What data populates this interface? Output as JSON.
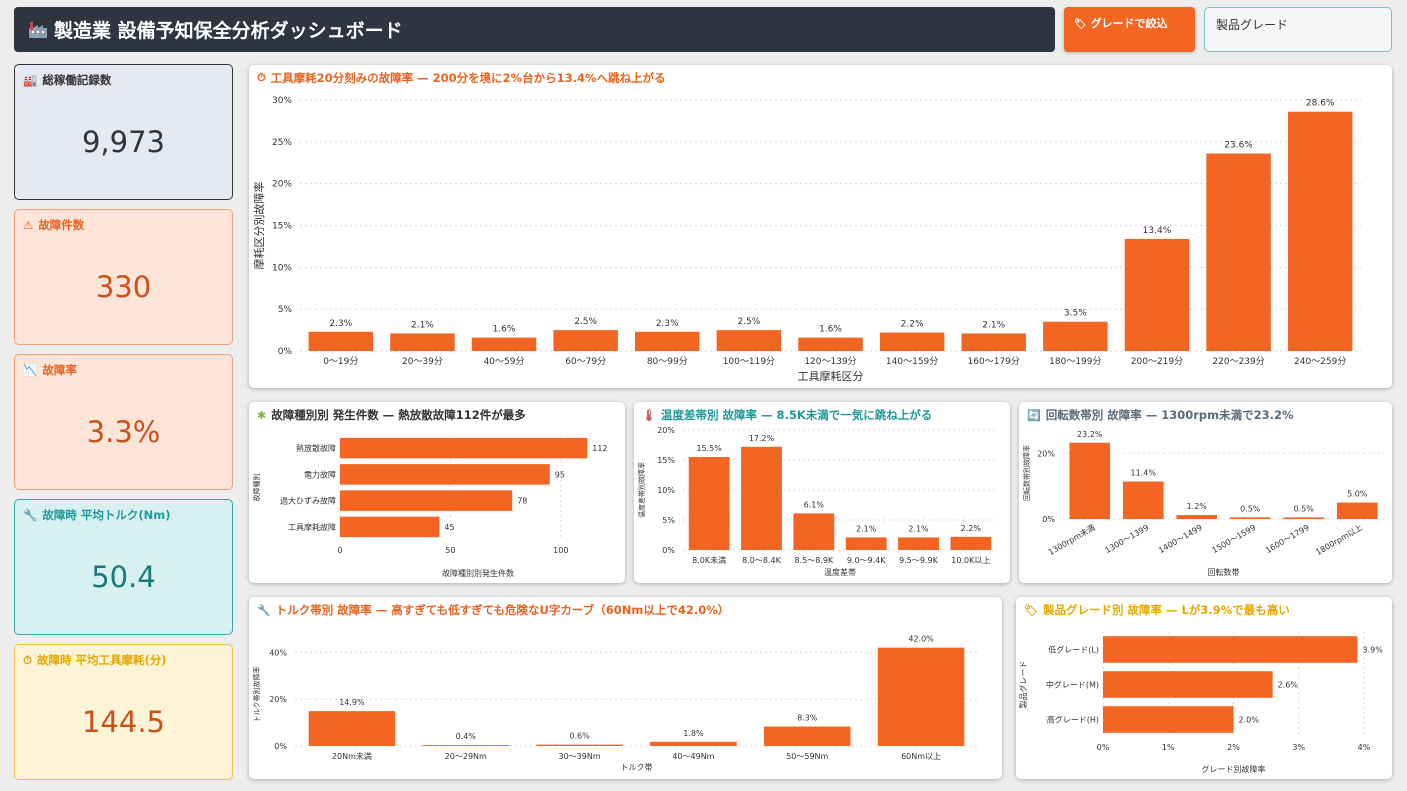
{
  "header": {
    "title": "製造業 設備予知保全分析ダッシュボード",
    "icon": "factory-icon"
  },
  "filter": {
    "button_label": "グレードで絞込",
    "select_placeholder": "製品グレード"
  },
  "kpis": [
    {
      "label": "総稼働記録数",
      "value": "9,973",
      "icon": "factory-icon",
      "bg": "#e6e9ef",
      "border": "#2e3440",
      "label_color": "#333333",
      "value_color": "#2e3440"
    },
    {
      "label": "故障件数",
      "value": "330",
      "icon": "warning-icon",
      "bg": "#fde4d8",
      "border": "#f0a07a",
      "label_color": "#e8631f",
      "value_color": "#c9511a"
    },
    {
      "label": "故障率",
      "value": "3.3%",
      "icon": "chart-down-icon",
      "bg": "#fde4d8",
      "border": "#f0a07a",
      "label_color": "#e8631f",
      "value_color": "#c9511a"
    },
    {
      "label": "故障時 平均トルク(Nm)",
      "value": "50.4",
      "icon": "wrench-icon",
      "bg": "#d9f0f0",
      "border": "#33a6a6",
      "label_color": "#1f9a9a",
      "value_color": "#167a7a"
    },
    {
      "label": "故障時 平均工具摩耗(分)",
      "value": "144.5",
      "icon": "stopwatch-icon",
      "bg": "#fdf3d6",
      "border": "#f2c24a",
      "label_color": "#e6a800",
      "value_color": "#c9511a"
    }
  ],
  "colors": {
    "bar": "#f26522",
    "grid": "#d8d8d8",
    "text": "#333333"
  },
  "charts": {
    "wear": {
      "title": "工具摩耗20分刻みの故障率 — 200分を境に2%台から13.4%へ跳ね上がる",
      "title_color": "#e8631f",
      "icon": "stopwatch-icon",
      "chart_data": {
        "type": "bar",
        "categories": [
          "0〜19分",
          "20〜39分",
          "40〜59分",
          "60〜79分",
          "80〜99分",
          "100〜119分",
          "120〜139分",
          "140〜159分",
          "160〜179分",
          "180〜199分",
          "200〜219分",
          "220〜239分",
          "240〜259分"
        ],
        "values": [
          2.3,
          2.1,
          1.6,
          2.5,
          2.3,
          2.5,
          1.6,
          2.2,
          2.1,
          3.5,
          13.4,
          23.6,
          28.6
        ],
        "value_labels": [
          "2.3%",
          "2.1%",
          "1.6%",
          "2.5%",
          "2.3%",
          "2.5%",
          "1.6%",
          "2.2%",
          "2.1%",
          "3.5%",
          "13.4%",
          "23.6%",
          "28.6%"
        ],
        "xlabel": "工具摩耗区分",
        "ylabel": "摩耗区分別故障率",
        "ylim": [
          0,
          30
        ],
        "yticks": [
          0,
          5,
          10,
          15,
          20,
          25,
          30
        ],
        "ytick_labels": [
          "0%",
          "5%",
          "10%",
          "15%",
          "20%",
          "25%",
          "30%"
        ],
        "grid": true
      }
    },
    "failtype": {
      "title": "故障種別別 発生件数 — 熱放散故障112件が最多",
      "title_color": "#333333",
      "icon": "gear-icon",
      "chart_data": {
        "type": "bar",
        "orientation": "horizontal",
        "categories": [
          "熱放散故障",
          "電力故障",
          "過大ひずみ故障",
          "工具摩耗故障"
        ],
        "values": [
          112,
          95,
          78,
          45
        ],
        "value_labels": [
          "112",
          "95",
          "78",
          "45"
        ],
        "xlabel": "故障種別別発生件数",
        "ylabel": "故障種別",
        "xlim": [
          0,
          125
        ],
        "xticks": [
          0,
          50,
          100
        ],
        "xtick_labels": [
          "0",
          "50",
          "100"
        ],
        "grid": true
      }
    },
    "temp": {
      "title": "温度差帯別 故障率 — 8.5K未満で一気に跳ね上がる",
      "title_color": "#1f9a9a",
      "icon": "thermometer-icon",
      "chart_data": {
        "type": "bar",
        "categories": [
          "8.0K未満",
          "8.0〜8.4K",
          "8.5〜8.9K",
          "9.0〜9.4K",
          "9.5〜9.9K",
          "10.0K以上"
        ],
        "values": [
          15.5,
          17.2,
          6.1,
          2.1,
          2.1,
          2.2
        ],
        "value_labels": [
          "15.5%",
          "17.2%",
          "6.1%",
          "2.1%",
          "2.1%",
          "2.2%"
        ],
        "xlabel": "温度差帯",
        "ylabel": "温度差帯別故障率",
        "ylim": [
          0,
          20
        ],
        "yticks": [
          0,
          5,
          10,
          15,
          20
        ],
        "ytick_labels": [
          "0%",
          "5%",
          "10%",
          "15%",
          "20%"
        ],
        "grid": true
      }
    },
    "rpm": {
      "title": "回転数帯別 故障率 — 1300rpm未満で23.2%",
      "title_color": "#5a6b7b",
      "icon": "refresh-icon",
      "chart_data": {
        "type": "bar",
        "categories": [
          "1300rpm未満",
          "1300〜1399",
          "1400〜1499",
          "1500〜1599",
          "1600〜1799",
          "1800rpm以上"
        ],
        "values": [
          23.2,
          11.4,
          1.2,
          0.5,
          0.5,
          5.0
        ],
        "value_labels": [
          "23.2%",
          "11.4%",
          "1.2%",
          "0.5%",
          "0.5%",
          "5.0%"
        ],
        "xlabel": "回転数帯",
        "ylabel": "回転数帯別故障率",
        "ylim": [
          0,
          28
        ],
        "yticks": [
          0,
          20
        ],
        "ytick_labels": [
          "0%",
          "20%"
        ],
        "grid": true
      }
    },
    "torque": {
      "title": "トルク帯別 故障率 — 高すぎても低すぎても危険なU字カーブ（60Nm以上で42.0%）",
      "title_color": "#e8631f",
      "icon": "wrench-icon",
      "chart_data": {
        "type": "bar",
        "categories": [
          "20Nm未満",
          "20〜29Nm",
          "30〜39Nm",
          "40〜49Nm",
          "50〜59Nm",
          "60Nm以上"
        ],
        "values": [
          14.9,
          0.4,
          0.6,
          1.8,
          8.3,
          42.0
        ],
        "value_labels": [
          "14.9%",
          "0.4%",
          "0.6%",
          "1.8%",
          "8.3%",
          "42.0%"
        ],
        "xlabel": "トルク帯",
        "ylabel": "トルク帯別故障率",
        "ylim": [
          0,
          44
        ],
        "yticks": [
          0,
          20,
          40
        ],
        "ytick_labels": [
          "0%",
          "20%",
          "40%"
        ],
        "grid": true
      }
    },
    "grade": {
      "title": "製品グレード別 故障率 — Lが3.9%で最も高い",
      "title_color": "#e6a800",
      "icon": "tag-icon",
      "chart_data": {
        "type": "bar",
        "orientation": "horizontal",
        "categories": [
          "低グレード(L)",
          "中グレード(M)",
          "高グレード(H)"
        ],
        "values": [
          3.9,
          2.6,
          2.0
        ],
        "value_labels": [
          "3.9%",
          "2.6%",
          "2.0%"
        ],
        "xlabel": "グレード別故障率",
        "ylabel": "製品グレード",
        "xlim": [
          0,
          4
        ],
        "xticks": [
          0,
          1,
          2,
          3,
          4
        ],
        "xtick_labels": [
          "0%",
          "1%",
          "2%",
          "3%",
          "4%"
        ],
        "grid": true
      }
    }
  }
}
